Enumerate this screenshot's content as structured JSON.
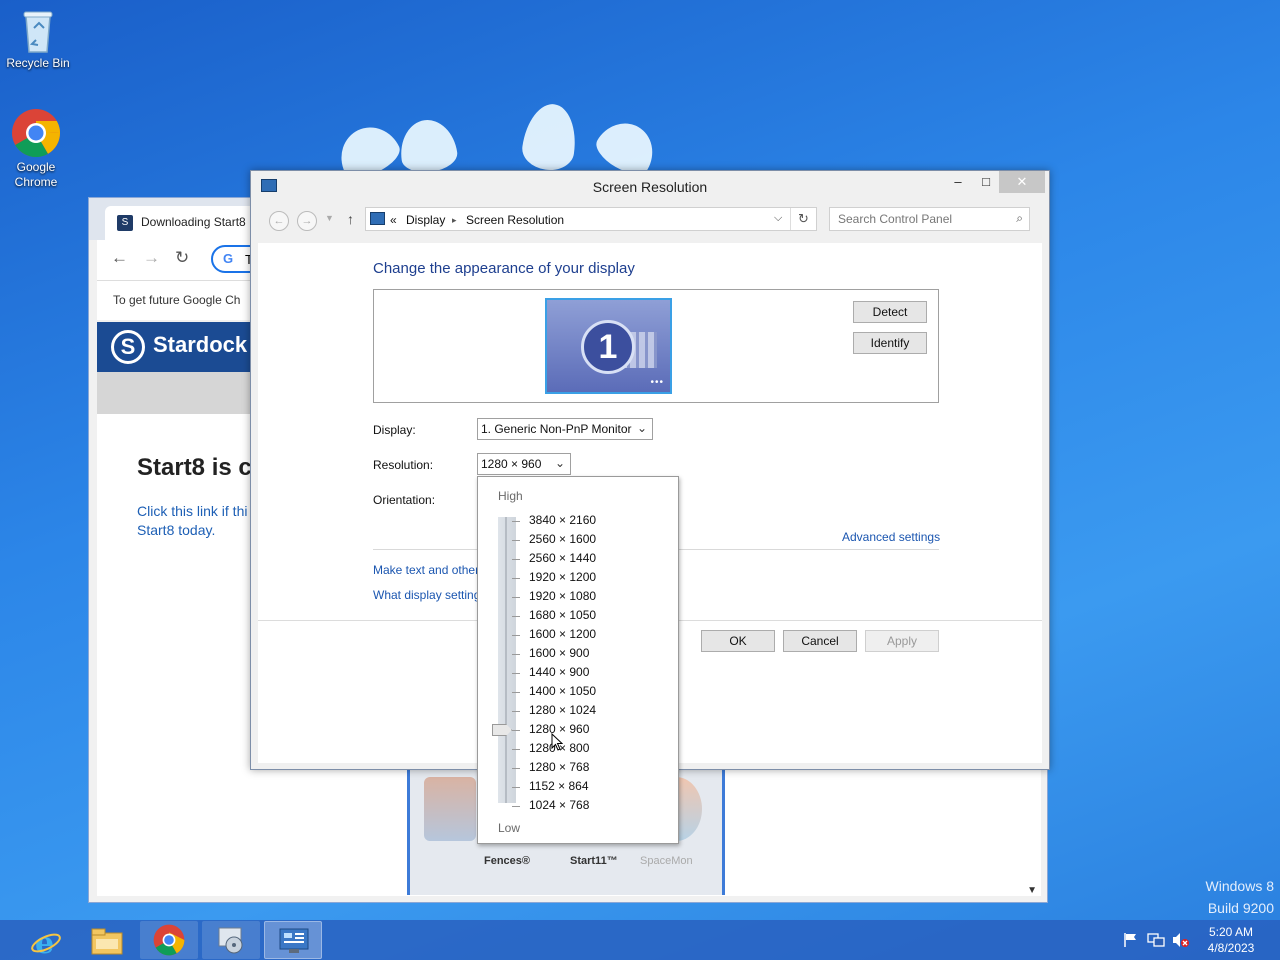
{
  "desktop": {
    "icons": [
      {
        "label": "Recycle Bin",
        "icon": "recycle-bin-icon"
      },
      {
        "label": "Google Chrome",
        "icon": "chrome-icon"
      }
    ],
    "watermark": {
      "line1": "Windows 8",
      "line2": "Build 9200"
    }
  },
  "browser": {
    "tab_title": "Downloading Start8",
    "omnibox_text": "Ta",
    "infobar_text": "To get future Google Ch",
    "banner_text": "Stardock",
    "heading": "Start8 is c",
    "link_line1": "Click this link if thi",
    "link_line2": "Start8 today.",
    "apps": [
      {
        "label": "Fences®"
      },
      {
        "label": "Start11™"
      },
      {
        "label": "SpaceMon"
      }
    ]
  },
  "dialog": {
    "title": "Screen Resolution",
    "window_buttons": {
      "minimize": "–",
      "maximize": "□",
      "close": "✕"
    },
    "breadcrumb": {
      "prefix": "«",
      "items": [
        "Display",
        "Screen Resolution"
      ],
      "separator": "▸"
    },
    "search_placeholder": "Search Control Panel",
    "heading": "Change the appearance of your display",
    "monitor_number": "1",
    "detect_label": "Detect",
    "identify_label": "Identify",
    "display_label": "Display:",
    "display_value": "1. Generic Non-PnP Monitor",
    "resolution_label": "Resolution:",
    "resolution_value": "1280 × 960",
    "orientation_label": "Orientation:",
    "advanced_settings": "Advanced settings",
    "link_make_text": "Make text and other",
    "link_what_display": "What display setting",
    "ok_label": "OK",
    "cancel_label": "Cancel",
    "apply_label": "Apply"
  },
  "resolution_popup": {
    "high_label": "High",
    "low_label": "Low",
    "options": [
      "3840 × 2160",
      "2560 × 1600",
      "2560 × 1440",
      "1920 × 1200",
      "1920 × 1080",
      "1680 × 1050",
      "1600 × 1200",
      "1600 × 900",
      "1440 × 900",
      "1400 × 1050",
      "1280 × 1024",
      "1280 × 960",
      "1280 × 800",
      "1280 × 768",
      "1152 × 864",
      "1024 × 768"
    ],
    "selected_index": 11
  },
  "taskbar": {
    "apps": [
      {
        "icon": "internet-explorer-icon",
        "state": "pinned"
      },
      {
        "icon": "file-explorer-icon",
        "state": "pinned"
      },
      {
        "icon": "chrome-icon",
        "state": "running"
      },
      {
        "icon": "installer-icon",
        "state": "running"
      },
      {
        "icon": "control-panel-icon",
        "state": "active"
      }
    ],
    "time": "5:20 AM",
    "date": "4/8/2023"
  },
  "colors": {
    "accent": "#1e3f8f",
    "link": "#1b56b0",
    "taskbar": "#285fbe"
  }
}
